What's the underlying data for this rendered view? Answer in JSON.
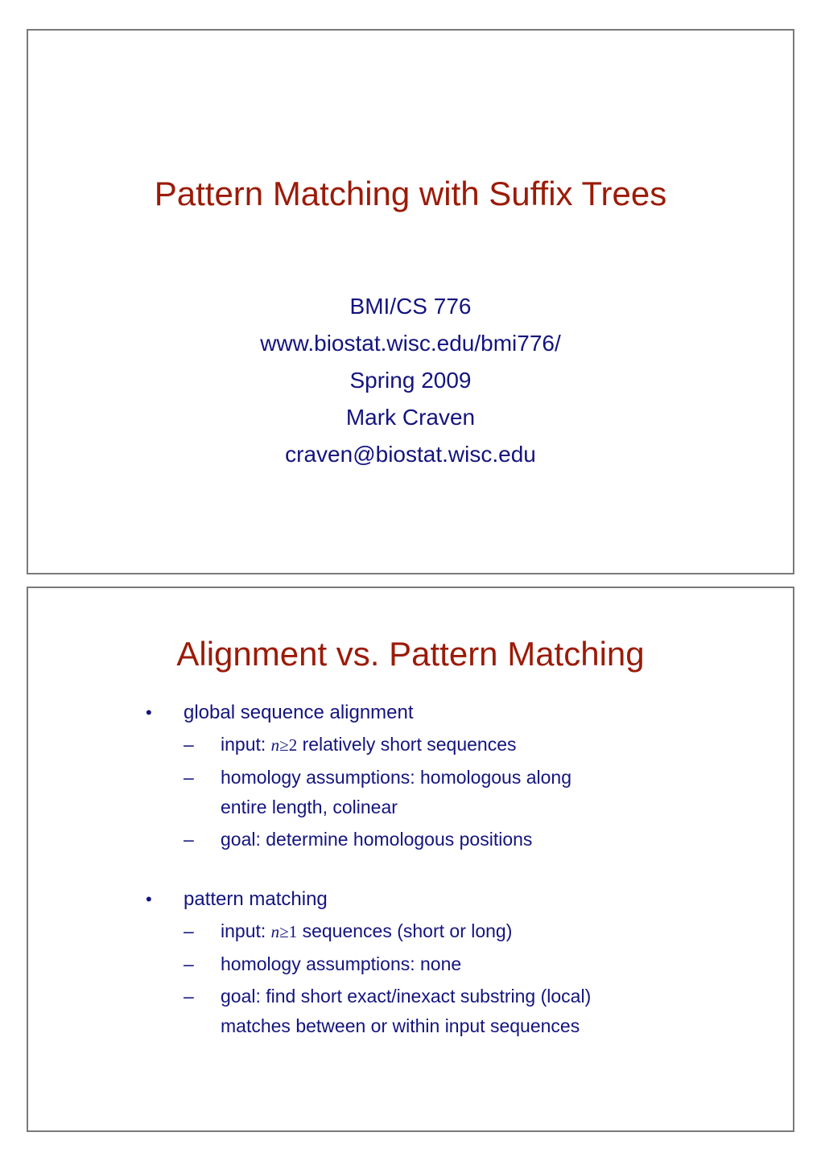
{
  "document": {
    "kind": "presentation-handout",
    "page_background": "#ffffff",
    "slide_border_color": "#7a7a7a",
    "title_color": "#9b1b07",
    "body_color": "#14147f"
  },
  "slides": [
    {
      "title": "Pattern Matching with Suffix Trees",
      "subtitle_lines": [
        "BMI/CS 776",
        "www.biostat.wisc.edu/bmi776/",
        "Spring 2009",
        "Mark Craven",
        "craven@biostat.wisc.edu"
      ]
    },
    {
      "title": "Alignment vs. Pattern Matching",
      "bullets": [
        {
          "marker": "•",
          "text": "global sequence alignment",
          "children": [
            {
              "marker": "–",
              "pre": "input: ",
              "var": "n",
              "op": "≥",
              "num": "2",
              "post": " relatively short sequences",
              "lines": []
            },
            {
              "marker": "–",
              "pre": "homology assumptions: homologous along",
              "var": "",
              "op": "",
              "num": "",
              "post": "",
              "lines": [
                "entire length, colinear"
              ]
            },
            {
              "marker": "–",
              "pre": "goal: determine homologous positions",
              "var": "",
              "op": "",
              "num": "",
              "post": "",
              "lines": []
            }
          ]
        },
        {
          "marker": "•",
          "text": "pattern matching",
          "children": [
            {
              "marker": "–",
              "pre": "input: ",
              "var": "n",
              "op": "≥",
              "num": "1",
              "post": " sequences (short or long)",
              "lines": []
            },
            {
              "marker": "–",
              "pre": "homology assumptions: none",
              "var": "",
              "op": "",
              "num": "",
              "post": "",
              "lines": []
            },
            {
              "marker": "–",
              "pre": "goal: find short exact/inexact substring (local)",
              "var": "",
              "op": "",
              "num": "",
              "post": "",
              "lines": [
                "matches between or within input sequences"
              ]
            }
          ]
        }
      ]
    }
  ]
}
